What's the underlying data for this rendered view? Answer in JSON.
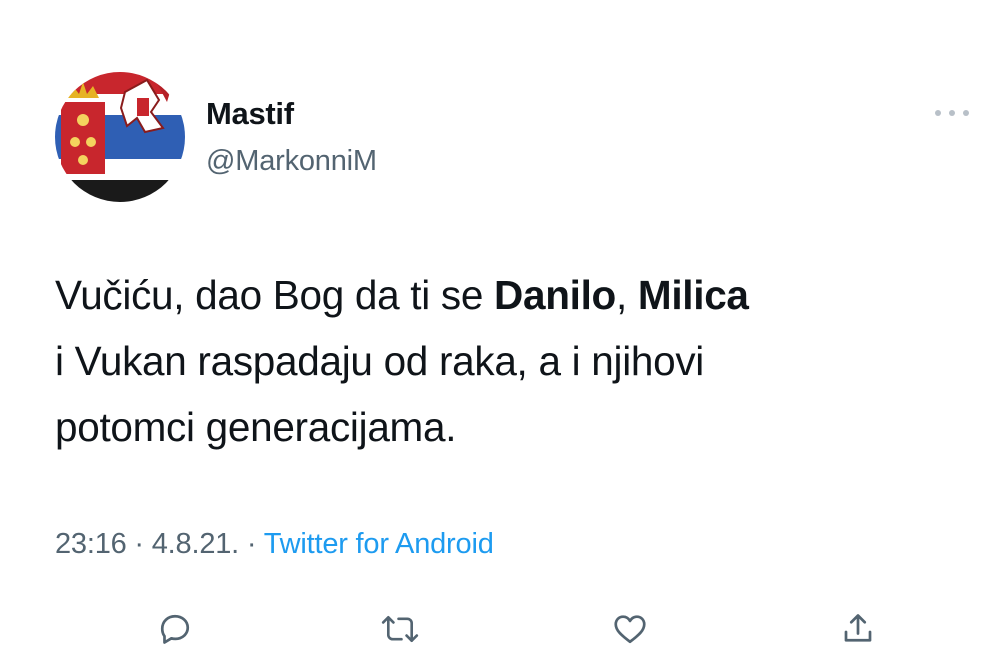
{
  "author": {
    "name": "Mastif",
    "handle": "@MarkonniM",
    "avatar_icon": "serbian-flag-avatar"
  },
  "tweet": {
    "text_parts": [
      {
        "text": "Vučiću, dao Bog da ti se ",
        "bold": false
      },
      {
        "text": "Danilo",
        "bold": true
      },
      {
        "text": ", ",
        "bold": false
      },
      {
        "text": "Milica",
        "bold": true
      },
      {
        "text": "\ni Vukan raspadaju od raka, a i njihovi\npotomci generacijama.",
        "bold": false
      }
    ]
  },
  "meta": {
    "time": "23:16",
    "separator1": " · ",
    "date": "4.8.21.",
    "separator2": " · ",
    "source": "Twitter for Android"
  },
  "actions": {
    "reply_icon": "reply-icon",
    "retweet_icon": "retweet-icon",
    "like_icon": "like-icon",
    "share_icon": "share-icon"
  },
  "colors": {
    "text_primary": "#0f1419",
    "text_secondary": "#536471",
    "link": "#1d9bf0"
  }
}
